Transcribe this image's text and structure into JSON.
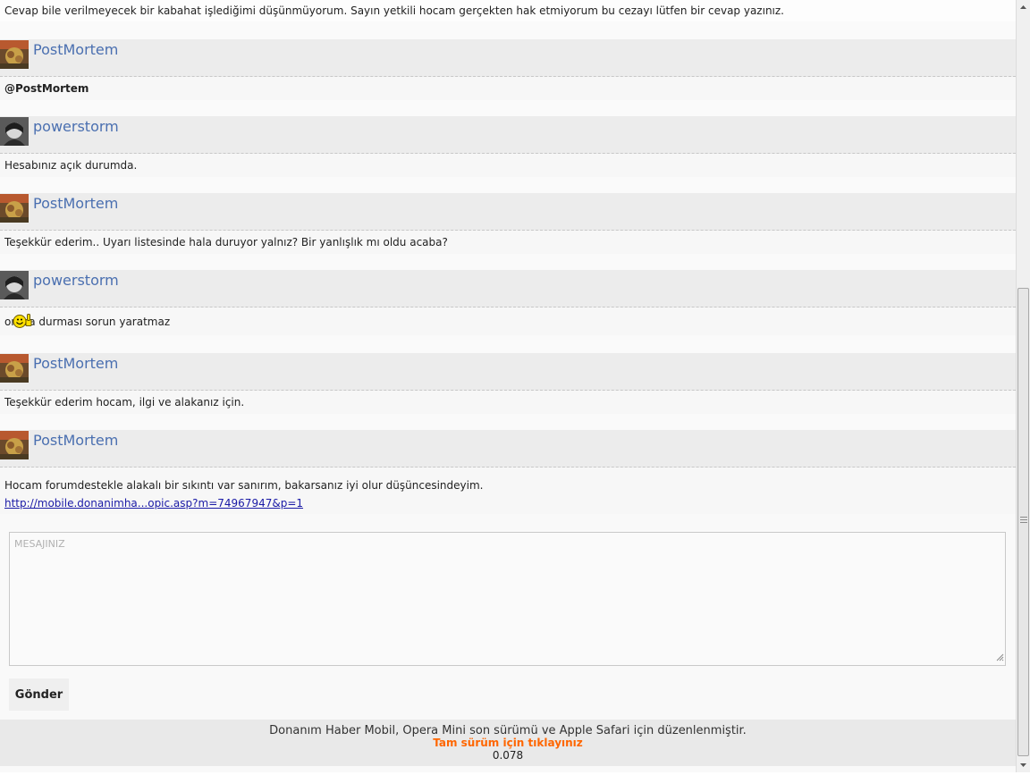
{
  "posts": [
    {
      "type": "text",
      "text": "Cevap bile verilmeyecek bir kabahat işlediğimi düşünmüyorum. Sayın yetkili hocam gerçekten hak etmiyorum bu cezayı lütfen bir cevap yazınız."
    },
    {
      "type": "header",
      "user": "PostMortem"
    },
    {
      "type": "text",
      "text": "@PostMortem"
    },
    {
      "type": "header",
      "user": "powerstorm"
    },
    {
      "type": "text",
      "text": "Hesabınız açık durumda."
    },
    {
      "type": "header",
      "user": "PostMortem"
    },
    {
      "type": "text",
      "text": "Teşekkür ederim.. Uyarı listesinde hala duruyor yalnız? Bir yanlışlık mı oldu acaba?"
    },
    {
      "type": "header",
      "user": "powerstorm"
    },
    {
      "type": "text",
      "text": "orada durması sorun yaratmaz",
      "icon": "thumbs-up-smiley-icon"
    },
    {
      "type": "header",
      "user": "PostMortem"
    },
    {
      "type": "text",
      "text": "Teşekkür ederim hocam, ilgi ve alakanız için."
    },
    {
      "type": "header",
      "user": "PostMortem"
    },
    {
      "type": "text",
      "text": "Hocam forumdestekle alakalı bir sıkıntı var sanırım, bakarsanız iyi olur düşüncesindeyim."
    },
    {
      "type": "link",
      "text": "http://mobile.donanimha...opic.asp?m=74967947&p=1"
    }
  ],
  "reply": {
    "placeholder": "MESAJINIZ",
    "send_label": "Gönder"
  },
  "footer": {
    "line1": "Donanım Haber Mobil, Opera Mini son sürümü ve Apple Safari için düzenlenmiştir.",
    "full_version": "Tam sürüm için tıklayınız",
    "version": "0.078"
  },
  "colors": {
    "username": "#4a6fb0",
    "link": "#1a1aa6",
    "full_version": "#ff6600",
    "header_bg": "#ececec"
  }
}
